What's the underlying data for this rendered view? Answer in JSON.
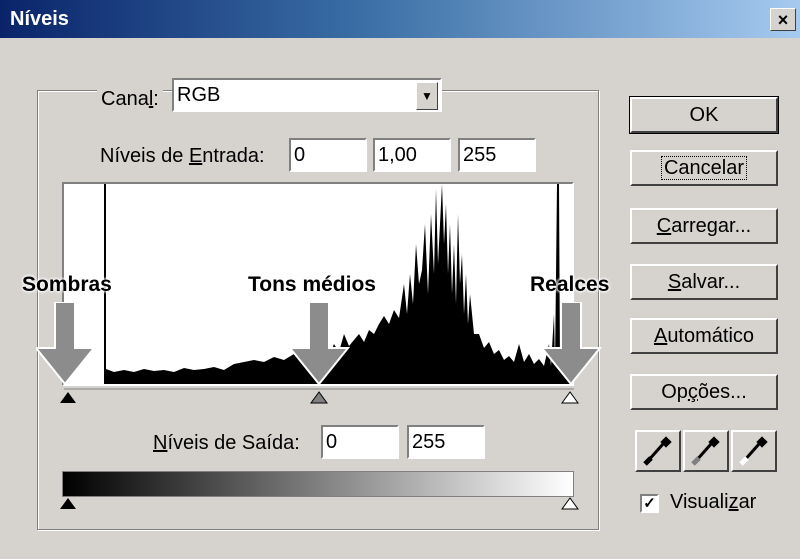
{
  "dialog": {
    "title": "Níveis",
    "close_label": "×"
  },
  "channel": {
    "label_pre": "Cana",
    "label_key": "l",
    "label_post": ":",
    "value": "RGB"
  },
  "input_levels": {
    "label_pre": "Níveis de ",
    "label_key": "E",
    "label_post": "ntrada:",
    "shadows": "0",
    "midtones": "1,00",
    "highlights": "255"
  },
  "output_levels": {
    "label_key": "N",
    "label_post": "íveis de Saída:",
    "low": "0",
    "high": "255"
  },
  "annotations": {
    "shadows": "Sombras",
    "midtones": "Tons médios",
    "highlights": "Realces"
  },
  "buttons": {
    "ok": "OK",
    "cancel": "Cancelar",
    "load_key": "C",
    "load_rest": "arregar...",
    "save_key": "S",
    "save_rest": "alvar...",
    "auto_key": "A",
    "auto_rest": "utomático",
    "options_pre": "Op",
    "options_key": "ç",
    "options_post": "ões..."
  },
  "preview": {
    "checked": true,
    "check_mark": "✓",
    "label_pre": "Visuali",
    "label_key": "z",
    "label_post": "ar"
  },
  "colors": {
    "arrow": "#8c8c8c",
    "histogram": "#000000"
  }
}
